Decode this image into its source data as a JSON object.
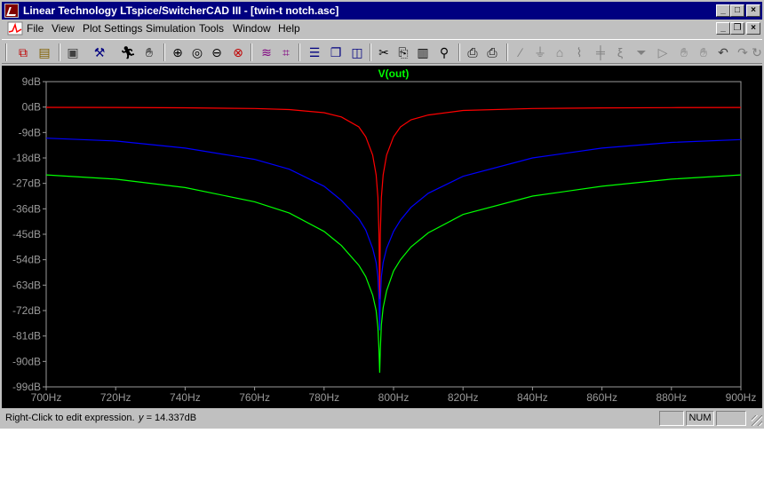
{
  "window": {
    "title": "Linear Technology LTspice/SwitcherCAD III - [twin-t notch.asc]",
    "caption_buttons": {
      "minimize": "_",
      "maximize": "□",
      "close": "×"
    },
    "mdi_buttons": {
      "minimize": "_",
      "restore": "❐",
      "close": "×"
    }
  },
  "menu": {
    "file": "File",
    "view": "View",
    "plot_settings": "Plot Settings",
    "simulation": "Simulation",
    "tools": "Tools",
    "window": "Window",
    "help": "Help"
  },
  "toolbar_icons": [
    "new-schematic-icon",
    "open-icon",
    "save-icon",
    "control-panel-icon",
    "run-icon",
    "halt-icon",
    "zoom-in-icon",
    "zoom-area-icon",
    "zoom-out-icon",
    "zoom-cancel-icon",
    "autorange-icon",
    "manual-limits-icon",
    "tile-horizontal-icon",
    "cascade-icon",
    "tile-vertical-icon",
    "cut-icon",
    "copy-icon",
    "paste-icon",
    "find-icon",
    "print-setup-icon",
    "print-icon",
    "wire-icon",
    "ground-icon",
    "label-icon",
    "resistor-icon",
    "capacitor-icon",
    "inductor-icon",
    "diode-icon",
    "component-icon",
    "move-icon",
    "drag-icon",
    "undo-icon",
    "redo-icon",
    "rotate-icon"
  ],
  "chart_data": {
    "type": "line",
    "title": "V(out)",
    "title_color": "#00ff00",
    "background": "#000000",
    "grid": true,
    "x_unit": "Hz",
    "y_unit": "dB",
    "xlim": [
      700,
      900
    ],
    "ylim": [
      -99,
      9
    ],
    "x_ticks": [
      "700Hz",
      "720Hz",
      "740Hz",
      "760Hz",
      "780Hz",
      "800Hz",
      "820Hz",
      "840Hz",
      "860Hz",
      "880Hz",
      "900Hz"
    ],
    "y_ticks": [
      "9dB",
      "0dB",
      "-9dB",
      "-18dB",
      "-27dB",
      "-36dB",
      "-45dB",
      "-54dB",
      "-63dB",
      "-72dB",
      "-81dB",
      "-90dB",
      "-99dB"
    ],
    "series": [
      {
        "color": "#ff0000",
        "x": [
          700,
          720,
          740,
          760,
          770,
          780,
          785,
          790,
          792,
          794,
          795,
          795.5,
          795.8,
          796,
          796.2,
          796.5,
          797,
          798,
          800,
          802,
          805,
          810,
          820,
          840,
          860,
          880,
          900
        ],
        "y": [
          -0.1,
          -0.15,
          -0.25,
          -0.5,
          -0.9,
          -2.0,
          -3.5,
          -7.0,
          -10.5,
          -17.0,
          -24.0,
          -32.0,
          -45.0,
          -68.0,
          -45.0,
          -32.0,
          -24.0,
          -17.0,
          -10.5,
          -7.0,
          -4.5,
          -2.8,
          -1.2,
          -0.5,
          -0.3,
          -0.2,
          -0.15
        ]
      },
      {
        "color": "#0000ff",
        "x": [
          700,
          720,
          740,
          760,
          770,
          780,
          785,
          790,
          792,
          794,
          795,
          795.5,
          795.8,
          796,
          796.2,
          796.5,
          797,
          798,
          800,
          802,
          805,
          810,
          820,
          840,
          860,
          880,
          900
        ],
        "y": [
          -11.0,
          -12.0,
          -14.5,
          -18.5,
          -22.0,
          -28.0,
          -33.0,
          -39.5,
          -43.5,
          -50.0,
          -55.0,
          -60.0,
          -68.0,
          -79.0,
          -68.0,
          -60.0,
          -55.0,
          -50.0,
          -44.0,
          -40.0,
          -35.5,
          -30.5,
          -24.5,
          -18.0,
          -14.5,
          -12.5,
          -11.5
        ]
      },
      {
        "color": "#00ff00",
        "x": [
          700,
          720,
          740,
          760,
          770,
          780,
          785,
          790,
          792,
          794,
          795,
          795.5,
          795.8,
          796,
          796.2,
          796.5,
          797,
          798,
          800,
          802,
          805,
          810,
          820,
          840,
          860,
          880,
          900
        ],
        "y": [
          -24.0,
          -25.5,
          -28.5,
          -33.5,
          -37.5,
          -44.0,
          -49.0,
          -56.0,
          -60.0,
          -66.5,
          -72.0,
          -78.0,
          -86.0,
          -94.0,
          -86.0,
          -77.0,
          -71.0,
          -65.0,
          -58.0,
          -54.0,
          -49.5,
          -44.5,
          -38.0,
          -31.5,
          -28.0,
          -25.5,
          -24.0
        ]
      }
    ]
  },
  "status": {
    "hint": "Right-Click to edit expression.",
    "y_label": "y",
    "y_value": "= 14.337dB",
    "num": "NUM"
  }
}
